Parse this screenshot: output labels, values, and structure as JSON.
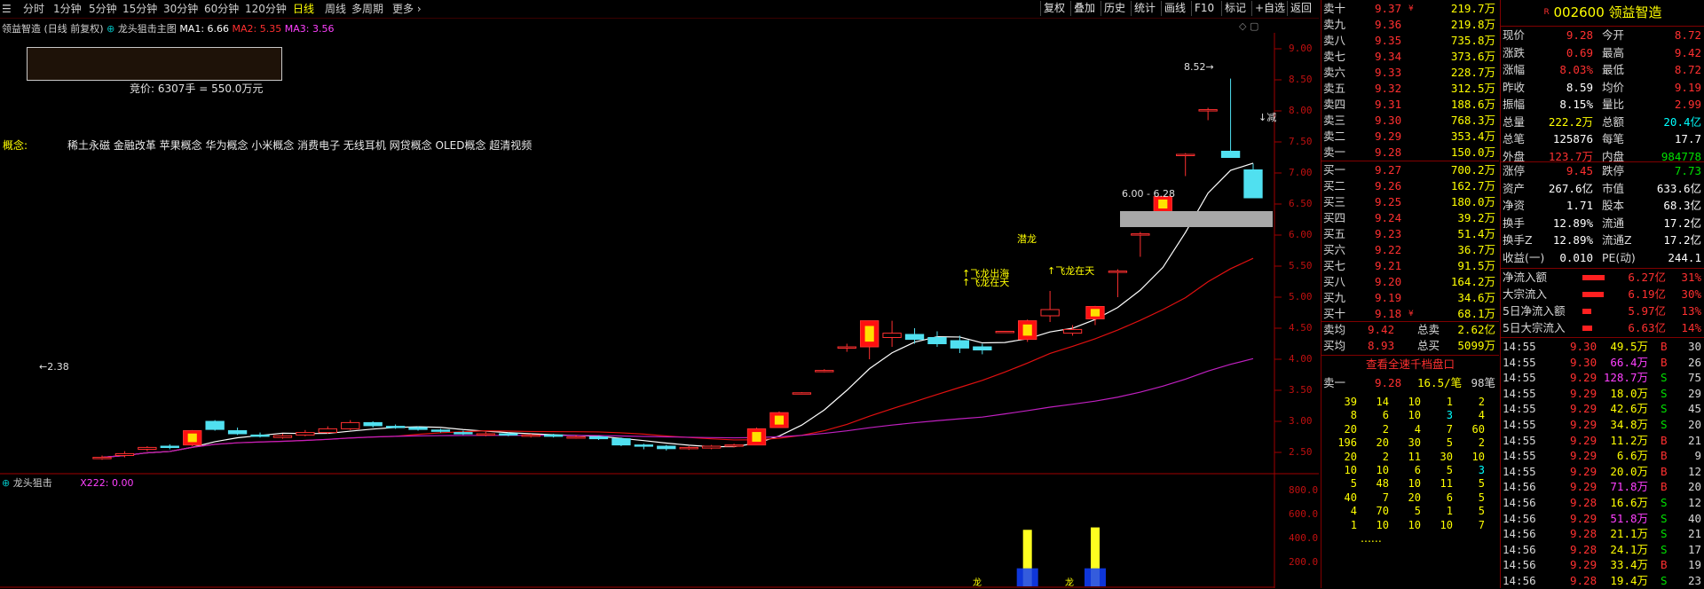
{
  "toolbar": {
    "periods": [
      "分时",
      "1分钟",
      "5分钟",
      "15分钟",
      "30分钟",
      "60分钟",
      "120分钟",
      "日线",
      "周线",
      "多周期",
      "更多"
    ],
    "active_period": "日线",
    "tools": [
      "复权",
      "叠加",
      "历史",
      "统计",
      "画线",
      "F10",
      "标记",
      "+自选",
      "返回"
    ]
  },
  "chart": {
    "stock_label": "领益智造",
    "chart_title": "龙头狙击主图",
    "adjust": "(日线 前复权)",
    "ma1": "MA1: 6.66",
    "ma2": "MA2: 5.35",
    "ma3": "MA3: 3.56",
    "auction": "竞价: 6307手 = 550.0万元",
    "concept_label": "概念:",
    "concepts": "稀土永磁 金融改革 苹果概念 华为概念 小米概念 消费电子 无线耳机 网贷概念 OLED概念 超清视频",
    "high_mark": "8.52",
    "low_mark": "2.38",
    "range_box": "6.00 - 6.28",
    "cut_label": "减",
    "ann_qianlong": "潜龙",
    "ann_feilong1": "飞龙在天",
    "ann_feilong2": "飞龙在天",
    "ann_feilong3": "飞龙出海",
    "yaxis": [
      "9.00",
      "8.50",
      "8.00",
      "7.50",
      "7.00",
      "6.50",
      "6.00",
      "5.50",
      "5.00",
      "4.50",
      "4.00",
      "3.50",
      "3.00",
      "2.50"
    ],
    "sub_title": "龙头狙击",
    "sub_value": "X222: 0.00",
    "sub_yaxis": [
      "800.0",
      "600.0",
      "400.0",
      "200.0"
    ],
    "sub_mark1": "龙",
    "sub_mark2": "龙"
  },
  "chart_data": {
    "type": "candlestick",
    "ylim": [
      2.3,
      9.2
    ],
    "candles": [
      {
        "o": 2.4,
        "c": 2.42,
        "h": 2.45,
        "l": 2.38
      },
      {
        "o": 2.45,
        "c": 2.48,
        "h": 2.52,
        "l": 2.42
      },
      {
        "o": 2.55,
        "c": 2.58,
        "h": 2.6,
        "l": 2.52
      },
      {
        "o": 2.6,
        "c": 2.58,
        "h": 2.63,
        "l": 2.55
      },
      {
        "o": 2.62,
        "c": 2.85,
        "h": 2.86,
        "l": 2.6
      },
      {
        "o": 3.0,
        "c": 2.87,
        "h": 3.02,
        "l": 2.85
      },
      {
        "o": 2.85,
        "c": 2.8,
        "h": 2.9,
        "l": 2.78
      },
      {
        "o": 2.78,
        "c": 2.76,
        "h": 2.82,
        "l": 2.74
      },
      {
        "o": 2.74,
        "c": 2.77,
        "h": 2.8,
        "l": 2.72
      },
      {
        "o": 2.78,
        "c": 2.82,
        "h": 2.86,
        "l": 2.76
      },
      {
        "o": 2.82,
        "c": 2.88,
        "h": 2.92,
        "l": 2.8
      },
      {
        "o": 2.88,
        "c": 2.98,
        "h": 3.02,
        "l": 2.86
      },
      {
        "o": 2.98,
        "c": 2.93,
        "h": 3.0,
        "l": 2.9
      },
      {
        "o": 2.92,
        "c": 2.9,
        "h": 2.95,
        "l": 2.88
      },
      {
        "o": 2.9,
        "c": 2.87,
        "h": 2.92,
        "l": 2.85
      },
      {
        "o": 2.86,
        "c": 2.84,
        "h": 2.88,
        "l": 2.82
      },
      {
        "o": 2.82,
        "c": 2.8,
        "h": 2.85,
        "l": 2.78
      },
      {
        "o": 2.78,
        "c": 2.8,
        "h": 2.83,
        "l": 2.76
      },
      {
        "o": 2.8,
        "c": 2.78,
        "h": 2.82,
        "l": 2.76
      },
      {
        "o": 2.76,
        "c": 2.78,
        "h": 2.8,
        "l": 2.74
      },
      {
        "o": 2.78,
        "c": 2.76,
        "h": 2.8,
        "l": 2.74
      },
      {
        "o": 2.74,
        "c": 2.75,
        "h": 2.78,
        "l": 2.72
      },
      {
        "o": 2.75,
        "c": 2.72,
        "h": 2.77,
        "l": 2.7
      },
      {
        "o": 2.72,
        "c": 2.62,
        "h": 2.74,
        "l": 2.6
      },
      {
        "o": 2.62,
        "c": 2.6,
        "h": 2.64,
        "l": 2.55
      },
      {
        "o": 2.6,
        "c": 2.56,
        "h": 2.62,
        "l": 2.53
      },
      {
        "o": 2.56,
        "c": 2.58,
        "h": 2.6,
        "l": 2.54
      },
      {
        "o": 2.57,
        "c": 2.6,
        "h": 2.62,
        "l": 2.55
      },
      {
        "o": 2.6,
        "c": 2.62,
        "h": 2.64,
        "l": 2.58
      },
      {
        "o": 2.62,
        "c": 2.88,
        "h": 2.9,
        "l": 2.62
      },
      {
        "o": 2.9,
        "c": 3.14,
        "h": 3.16,
        "l": 2.9
      },
      {
        "o": 3.45,
        "c": 3.46,
        "h": 3.47,
        "l": 3.44
      },
      {
        "o": 3.8,
        "c": 3.82,
        "h": 3.84,
        "l": 3.79
      },
      {
        "o": 4.18,
        "c": 4.2,
        "h": 4.25,
        "l": 4.12
      },
      {
        "o": 4.2,
        "c": 4.62,
        "h": 4.62,
        "l": 4.0
      },
      {
        "o": 4.35,
        "c": 4.42,
        "h": 4.62,
        "l": 4.2
      },
      {
        "o": 4.4,
        "c": 4.32,
        "h": 4.5,
        "l": 4.25
      },
      {
        "o": 4.35,
        "c": 4.25,
        "h": 4.45,
        "l": 4.2
      },
      {
        "o": 4.3,
        "c": 4.18,
        "h": 4.38,
        "l": 4.1
      },
      {
        "o": 4.2,
        "c": 4.15,
        "h": 4.25,
        "l": 4.08
      },
      {
        "o": 4.45,
        "c": 4.45,
        "h": 4.45,
        "l": 4.45
      },
      {
        "o": 4.32,
        "c": 4.62,
        "h": 4.64,
        "l": 4.28
      },
      {
        "o": 4.7,
        "c": 4.8,
        "h": 5.1,
        "l": 4.6
      },
      {
        "o": 4.42,
        "c": 4.48,
        "h": 4.55,
        "l": 4.38
      },
      {
        "o": 4.65,
        "c": 4.85,
        "h": 4.86,
        "l": 4.55
      },
      {
        "o": 5.4,
        "c": 5.42,
        "h": 5.45,
        "l": 5.0
      },
      {
        "o": 6.0,
        "c": 6.02,
        "h": 6.05,
        "l": 5.65
      },
      {
        "o": 6.38,
        "c": 6.62,
        "h": 6.63,
        "l": 6.38
      },
      {
        "o": 7.28,
        "c": 7.3,
        "h": 7.32,
        "l": 6.95
      },
      {
        "o": 8.0,
        "c": 8.02,
        "h": 8.05,
        "l": 7.85
      },
      {
        "o": 7.35,
        "c": 7.25,
        "h": 8.52,
        "l": 7.25
      },
      {
        "o": 7.05,
        "c": 6.6,
        "h": 7.15,
        "l": 6.6
      }
    ],
    "volume_bars": [
      {
        "index": 41,
        "value": 470
      },
      {
        "index": 44,
        "value": 490
      }
    ]
  },
  "quote": {
    "asks": [
      {
        "label": "卖十",
        "price": "9.37",
        "vol": "219.7万",
        "flag": "¥"
      },
      {
        "label": "卖九",
        "price": "9.36",
        "vol": "219.8万"
      },
      {
        "label": "卖八",
        "price": "9.35",
        "vol": "735.8万"
      },
      {
        "label": "卖七",
        "price": "9.34",
        "vol": "373.6万"
      },
      {
        "label": "卖六",
        "price": "9.33",
        "vol": "228.7万"
      },
      {
        "label": "卖五",
        "price": "9.32",
        "vol": "312.5万"
      },
      {
        "label": "卖四",
        "price": "9.31",
        "vol": "188.6万"
      },
      {
        "label": "卖三",
        "price": "9.30",
        "vol": "768.3万"
      },
      {
        "label": "卖二",
        "price": "9.29",
        "vol": "353.4万"
      },
      {
        "label": "卖一",
        "price": "9.28",
        "vol": "150.0万"
      }
    ],
    "bids": [
      {
        "label": "买一",
        "price": "9.27",
        "vol": "700.2万"
      },
      {
        "label": "买二",
        "price": "9.26",
        "vol": "162.7万"
      },
      {
        "label": "买三",
        "price": "9.25",
        "vol": "180.0万"
      },
      {
        "label": "买四",
        "price": "9.24",
        "vol": "39.2万"
      },
      {
        "label": "买五",
        "price": "9.23",
        "vol": "51.4万"
      },
      {
        "label": "买六",
        "price": "9.22",
        "vol": "36.7万"
      },
      {
        "label": "买七",
        "price": "9.21",
        "vol": "91.5万"
      },
      {
        "label": "买八",
        "price": "9.20",
        "vol": "164.2万"
      },
      {
        "label": "买九",
        "price": "9.19",
        "vol": "34.6万"
      },
      {
        "label": "买十",
        "price": "9.18",
        "vol": "68.1万",
        "flag": "¥"
      }
    ],
    "avg_sell_label": "卖均",
    "avg_sell": "9.42",
    "total_sell_label": "总卖",
    "total_sell": "2.62亿",
    "avg_buy_label": "买均",
    "avg_buy": "8.93",
    "total_buy_label": "总买",
    "total_buy": "5099万",
    "depth_link": "查看全速千档盘口",
    "depth_head": {
      "label": "卖一",
      "price": "9.28",
      "per": "16.5/笔",
      "count": "98笔"
    },
    "depth_rows": [
      [
        "39",
        "14",
        "10",
        "1",
        "2"
      ],
      [
        "8",
        "6",
        "10",
        "3",
        "4"
      ],
      [
        "20",
        "2",
        "4",
        "7",
        "60"
      ],
      [
        "196",
        "20",
        "30",
        "5",
        "2"
      ],
      [
        "20",
        "2",
        "11",
        "30",
        "10"
      ],
      [
        "10",
        "10",
        "6",
        "5",
        "3"
      ],
      [
        "5",
        "48",
        "10",
        "11",
        "5"
      ],
      [
        "40",
        "7",
        "20",
        "6",
        "5"
      ],
      [
        "4",
        "70",
        "5",
        "1",
        "5"
      ],
      [
        "1",
        "10",
        "10",
        "10",
        "7"
      ]
    ],
    "depth_more": "......"
  },
  "info": {
    "code": "002600",
    "name": "领益智造",
    "r_mark": "R",
    "stats": [
      [
        "现价",
        "9.28",
        "今开",
        "8.72"
      ],
      [
        "涨跌",
        "0.69",
        "最高",
        "9.42"
      ],
      [
        "涨幅",
        "8.03%",
        "最低",
        "8.72"
      ],
      [
        "昨收",
        "8.59",
        "均价",
        "9.19"
      ],
      [
        "振幅",
        "8.15%",
        "量比",
        "2.99"
      ],
      [
        "总量",
        "222.2万",
        "总额",
        "20.4亿"
      ],
      [
        "总笔",
        "125876",
        "每笔",
        "17.7"
      ],
      [
        "外盘",
        "123.7万",
        "内盘",
        "984778"
      ]
    ],
    "stats2": [
      [
        "涨停",
        "9.45",
        "跌停",
        "7.73"
      ],
      [
        "资产",
        "267.6亿",
        "市值",
        "633.6亿"
      ],
      [
        "净资",
        "1.71",
        "股本",
        "68.3亿"
      ],
      [
        "换手",
        "12.89%",
        "流通",
        "17.2亿"
      ],
      [
        "换手Z",
        "12.89%",
        "流通Z",
        "17.2亿"
      ],
      [
        "收益(一)",
        "0.010",
        "PE(动)",
        "244.1"
      ]
    ],
    "flows": [
      {
        "label": "净流入额",
        "value": "6.27亿",
        "pct": "31%",
        "fill": 0.31
      },
      {
        "label": "大宗流入",
        "value": "6.19亿",
        "pct": "30%",
        "fill": 0.3
      },
      {
        "label": "5日净流入额",
        "value": "5.97亿",
        "pct": "13%",
        "fill": 0.13
      },
      {
        "label": "5日大宗流入",
        "value": "6.63亿",
        "pct": "14%",
        "fill": 0.14
      }
    ],
    "ticks": [
      [
        "14:55",
        "9.30",
        "49.5万",
        "B",
        "30"
      ],
      [
        "14:55",
        "9.30",
        "66.4万",
        "B",
        "26"
      ],
      [
        "14:55",
        "9.29",
        "128.7万",
        "S",
        "75"
      ],
      [
        "14:55",
        "9.29",
        "18.0万",
        "S",
        "29"
      ],
      [
        "14:55",
        "9.29",
        "42.6万",
        "S",
        "45"
      ],
      [
        "14:55",
        "9.29",
        "34.8万",
        "S",
        "20"
      ],
      [
        "14:55",
        "9.29",
        "11.2万",
        "B",
        "21"
      ],
      [
        "14:55",
        "9.29",
        "6.6万",
        "B",
        "9"
      ],
      [
        "14:55",
        "9.29",
        "20.0万",
        "B",
        "12"
      ],
      [
        "14:56",
        "9.29",
        "71.8万",
        "B",
        "20"
      ],
      [
        "14:56",
        "9.28",
        "16.6万",
        "S",
        "12"
      ],
      [
        "14:56",
        "9.29",
        "51.8万",
        "S",
        "40"
      ],
      [
        "14:56",
        "9.28",
        "21.1万",
        "S",
        "21"
      ],
      [
        "14:56",
        "9.28",
        "24.1万",
        "S",
        "17"
      ],
      [
        "14:56",
        "9.29",
        "33.4万",
        "B",
        "19"
      ],
      [
        "14:56",
        "9.28",
        "19.4万",
        "S",
        "23"
      ]
    ]
  }
}
